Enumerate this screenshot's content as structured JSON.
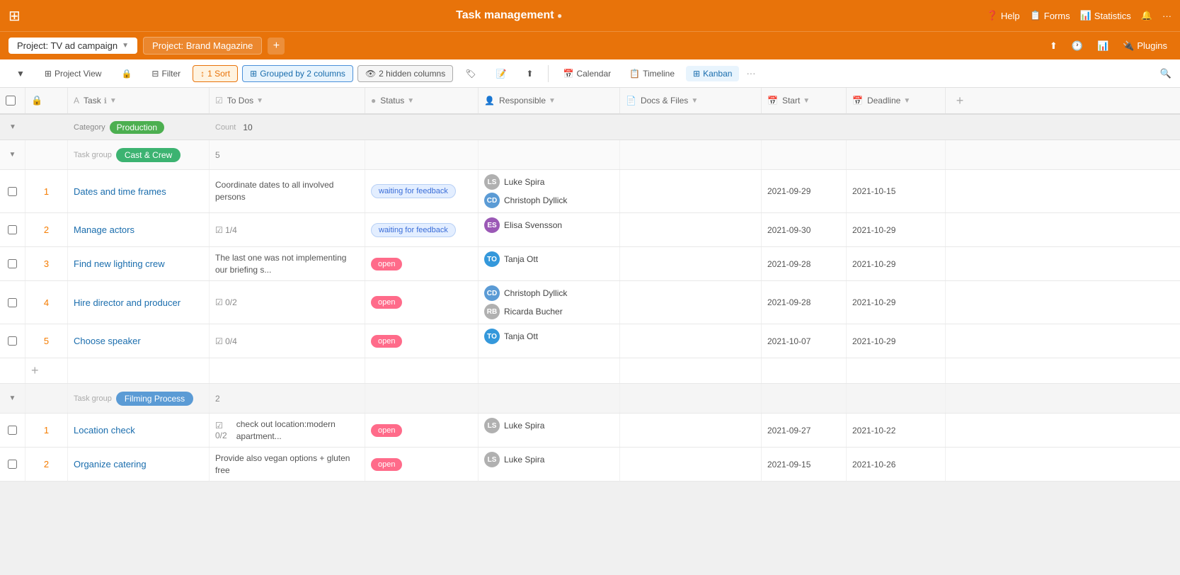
{
  "app": {
    "title": "Task management",
    "info_icon": "ℹ"
  },
  "top_nav": {
    "help": "Help",
    "forms": "Forms",
    "statistics": "Statistics",
    "plugins": "Plugins"
  },
  "tabs": [
    {
      "label": "Project: TV ad campaign",
      "active": true
    },
    {
      "label": "Project: Brand Magazine",
      "active": false
    }
  ],
  "right_actions": [
    "share-icon",
    "clock-icon",
    "excel-icon",
    "plugin-icon",
    "Plugins"
  ],
  "toolbar": {
    "project_view": "Project View",
    "filter": "Filter",
    "sort": "1 Sort",
    "grouped": "Grouped by 2 columns",
    "hidden": "2 hidden columns",
    "calendar": "Calendar",
    "timeline": "Timeline",
    "kanban": "Kanban"
  },
  "columns": [
    {
      "label": "",
      "icon": ""
    },
    {
      "label": "",
      "icon": "lock"
    },
    {
      "label": "Task",
      "icon": "A",
      "has_info": true,
      "sortable": true
    },
    {
      "label": "To Dos",
      "icon": "checkbox",
      "sortable": true
    },
    {
      "label": "Status",
      "icon": "circle",
      "sortable": true
    },
    {
      "label": "Responsible",
      "icon": "person",
      "sortable": true
    },
    {
      "label": "Docs & Files",
      "icon": "doc",
      "sortable": true
    },
    {
      "label": "Start",
      "icon": "cal",
      "sortable": true
    },
    {
      "label": "Deadline",
      "icon": "cal",
      "sortable": true
    },
    {
      "label": "+",
      "icon": ""
    }
  ],
  "category": {
    "label": "Category",
    "name": "Production",
    "count_label": "Count",
    "count": "10"
  },
  "groups": [
    {
      "label": "Task group",
      "name": "Cast & Crew",
      "color": "badge-green",
      "count": "5",
      "tasks": [
        {
          "num": "1",
          "name": "Dates and time frames",
          "todo": "Coordinate dates to all involved persons",
          "todo_check": null,
          "status": "waiting for feedback",
          "status_type": "waiting",
          "users": [
            "Luke Spira",
            "Christoph Dyllick"
          ],
          "user_types": [
            "gray",
            "avatar-img"
          ],
          "start": "2021-09-29",
          "deadline": "2021-10-15"
        },
        {
          "num": "2",
          "name": "Manage actors",
          "todo": null,
          "todo_check": "1/4",
          "status": "waiting for feedback",
          "status_type": "waiting",
          "users": [
            "Elisa Svensson"
          ],
          "user_types": [
            "avatar-img"
          ],
          "start": "2021-09-30",
          "deadline": "2021-10-29"
        },
        {
          "num": "3",
          "name": "Find new lighting crew",
          "todo": "The last one was not implementing our briefing s...",
          "todo_check": null,
          "status": "open",
          "status_type": "open",
          "users": [
            "Tanja Ott"
          ],
          "user_types": [
            "avatar-img"
          ],
          "start": "2021-09-28",
          "deadline": "2021-10-29"
        },
        {
          "num": "4",
          "name": "Hire director and producer",
          "todo": null,
          "todo_check": "0/2",
          "status": "open",
          "status_type": "open",
          "users": [
            "Christoph Dyllick",
            "Ricarda Bucher"
          ],
          "user_types": [
            "avatar-img",
            "gray"
          ],
          "start": "2021-09-28",
          "deadline": "2021-10-29"
        },
        {
          "num": "5",
          "name": "Choose speaker",
          "todo": null,
          "todo_check": "0/4",
          "status": "open",
          "status_type": "open",
          "users": [
            "Tanja Ott"
          ],
          "user_types": [
            "avatar-img"
          ],
          "start": "2021-10-07",
          "deadline": "2021-10-29"
        }
      ]
    },
    {
      "label": "Task group",
      "name": "Filming Process",
      "color": "badge-blue",
      "count": "2",
      "tasks": [
        {
          "num": "1",
          "name": "Location check",
          "todo": "check out location:modern apartment...",
          "todo_check": "0/2",
          "status": "open",
          "status_type": "open",
          "users": [
            "Luke Spira"
          ],
          "user_types": [
            "gray"
          ],
          "start": "2021-09-27",
          "deadline": "2021-10-22"
        },
        {
          "num": "2",
          "name": "Organize catering",
          "todo": "Provide also vegan options + gluten free",
          "todo_check": null,
          "status": "open",
          "status_type": "open",
          "users": [
            "Luke Spira"
          ],
          "user_types": [
            "gray"
          ],
          "start": "2021-09-15",
          "deadline": "2021-10-26"
        }
      ]
    }
  ]
}
